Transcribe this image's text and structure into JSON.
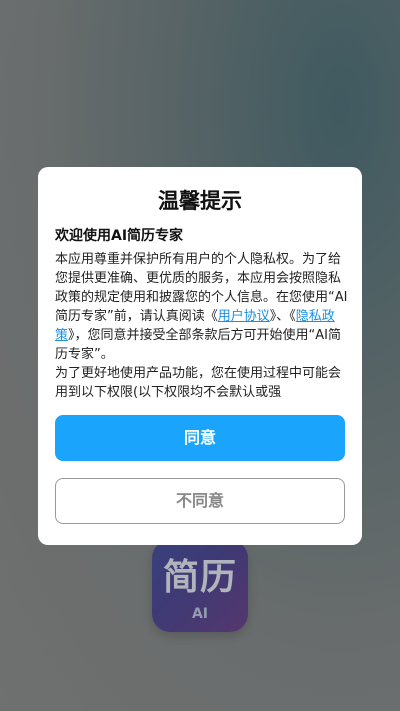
{
  "app_icon": {
    "title": "简历",
    "subtitle": "AI"
  },
  "dialog": {
    "title": "温馨提示",
    "welcome": "欢迎使用AI简历专家",
    "body": {
      "p1_before": "本应用尊重并保护所有用户的个人隐私权。为了给您提供更准确、更优质的服务，本应用会按照隐私政策的规定使用和披露您的个人信息。在您使用“AI简历专家”前，请认真阅读《",
      "user_agreement_link": "用户协议",
      "p1_between": "》、《",
      "privacy_policy_link": "隐私政策",
      "p1_after": "》，您同意并接受全部条款后方可开始使用“AI简历专家”。",
      "p2": "为了更好地使用产品功能，您在使用过程中可能会用到以下权限(以下权限均不会默认或强"
    },
    "agree_label": "同意",
    "disagree_label": "不同意"
  }
}
